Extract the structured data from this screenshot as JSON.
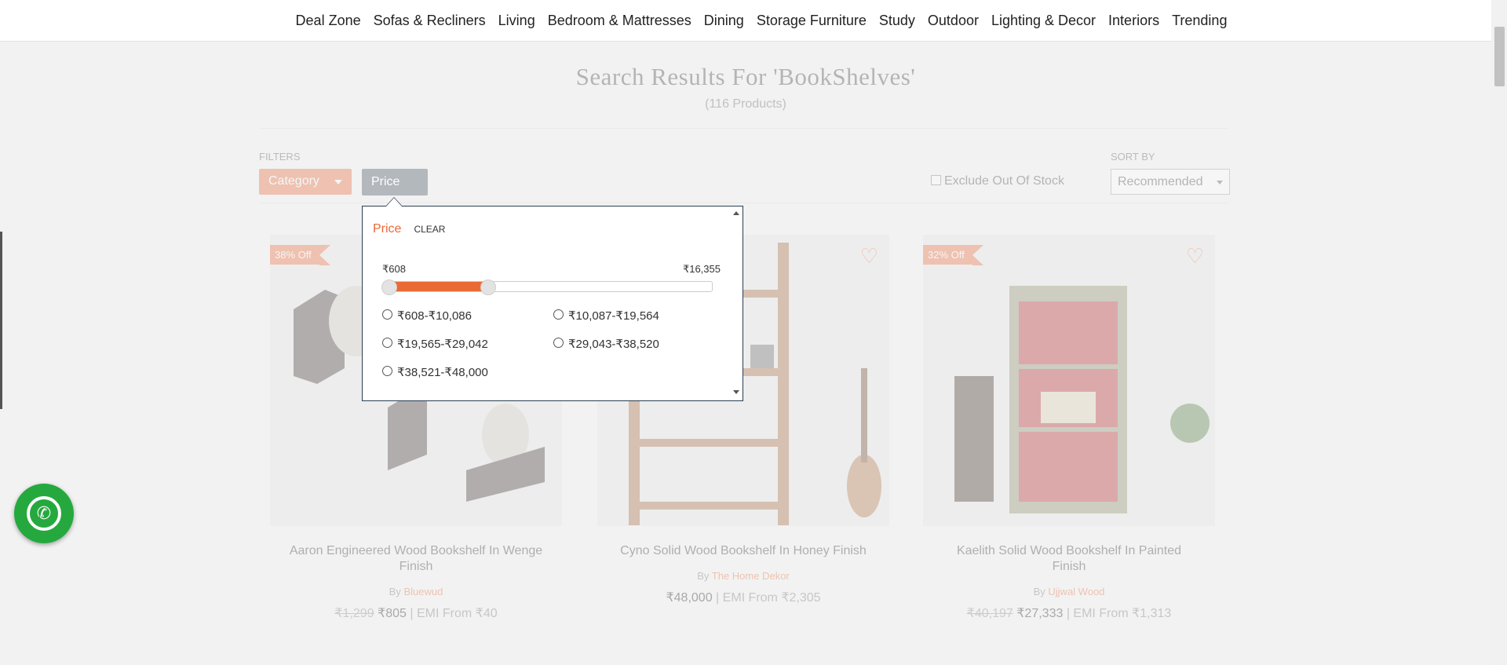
{
  "nav": {
    "items": [
      "Deal Zone",
      "Sofas & Recliners",
      "Living",
      "Bedroom & Mattresses",
      "Dining",
      "Storage Furniture",
      "Study",
      "Outdoor",
      "Lighting & Decor",
      "Interiors",
      "Trending"
    ]
  },
  "search": {
    "title": "Search Results For 'BookShelves'",
    "count": "(116 Products)"
  },
  "filters": {
    "label": "FILTERS",
    "category": "Category",
    "price": "Price",
    "exclude_out_of_stock": "Exclude Out Of Stock",
    "sort_label": "SORT BY",
    "sort_value": "Recommended"
  },
  "price_popup": {
    "title": "Price",
    "clear": "CLEAR",
    "min_label": "₹608",
    "max_label": "₹16,355",
    "range_low_fraction": 0.0,
    "range_high_fraction": 0.32,
    "options": [
      "₹608-₹10,086",
      "₹10,087-₹19,564",
      "₹19,565-₹29,042",
      "₹29,043-₹38,520",
      "₹38,521-₹48,000"
    ]
  },
  "products": [
    {
      "discount": "38% Off",
      "name": "Aaron Engineered Wood Bookshelf In Wenge Finish",
      "by": "By",
      "brand": "Bluewud",
      "old_price": "₹1,299",
      "price": "₹805",
      "emi": "| EMI From ₹40"
    },
    {
      "discount": "",
      "name": "Cyno Solid Wood Bookshelf In Honey Finish",
      "by": "By",
      "brand": "The Home Dekor",
      "old_price": "",
      "price": "₹48,000",
      "emi": "| EMI From ₹2,305"
    },
    {
      "discount": "32% Off",
      "name": "Kaelith Solid Wood Bookshelf In Painted Finish",
      "by": "By",
      "brand": "Ujjwal Wood",
      "old_price": "₹40,197",
      "price": "₹27,333",
      "emi": "| EMI From ₹1,313"
    }
  ],
  "colors": {
    "accent": "#e8693a",
    "popup_border": "#2b3d52",
    "whatsapp": "#25a93e"
  }
}
